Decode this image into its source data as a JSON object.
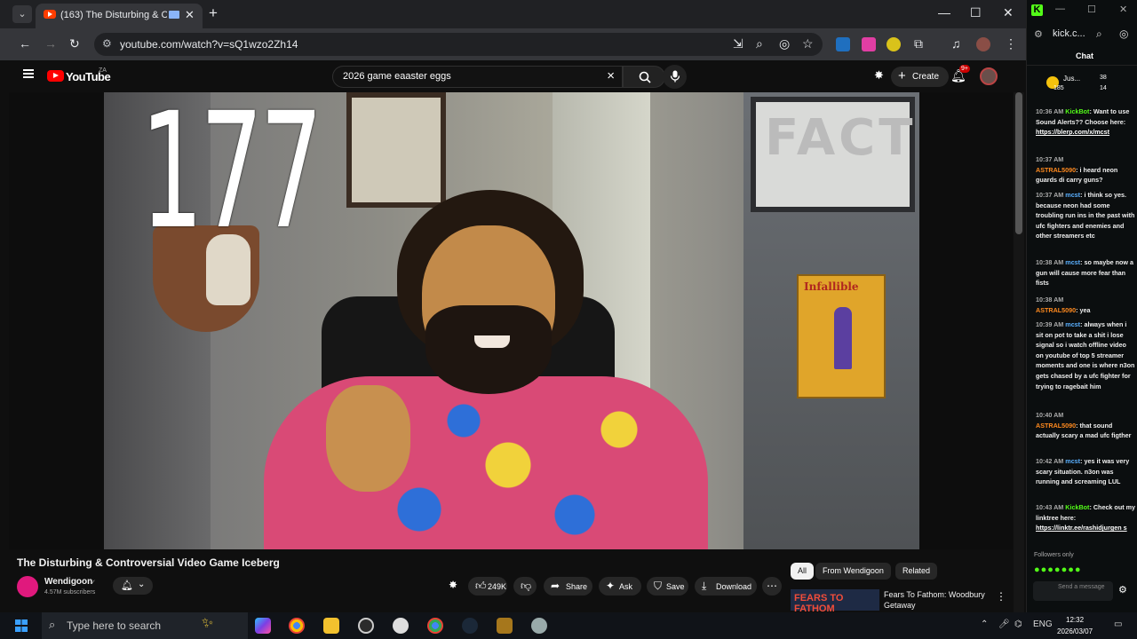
{
  "browser": {
    "tab_title": "(163) The Disturbing & Con",
    "url": "youtube.com/watch?v=sQ1wzo2Zh14",
    "new_tab": "+"
  },
  "youtube": {
    "logo_text": "YouTube",
    "country_code": "ZA",
    "search_query": "2026 game eaaster eggs",
    "create_label": "Create",
    "notification_count": "9+",
    "video": {
      "overlay_number": "177",
      "poster_text": "Infallible",
      "wall_text": "FACT",
      "title": "The Disturbing & Controversial Video Game Iceberg"
    },
    "channel": {
      "name": "Wendigoon",
      "subscribers": "4.57M subscribers"
    },
    "actions": {
      "likes": "249K",
      "share": "Share",
      "ask": "Ask",
      "save": "Save",
      "download": "Download"
    },
    "chips": [
      "All",
      "From Wendigoon",
      "Related"
    ],
    "recommendation": {
      "thumb_text": "FEARS TO FATHOM",
      "title": "Fears To Fathom: Woodbury Getaway"
    }
  },
  "kick": {
    "url": "kick.c...",
    "chat_label": "Chat",
    "user": "Jus...",
    "stats": [
      "185",
      "38",
      "14"
    ],
    "messages": [
      {
        "time": "10:36 AM",
        "name": "KickBot",
        "text": "Want to use Sound Alerts?? Choose here:",
        "link": "https://blerp.com/x/mcst"
      },
      {
        "time": "10:37 AM",
        "name": "ASTRAL5090",
        "text": "i heard neon guards di carry guns?"
      },
      {
        "time": "10:37 AM",
        "name": "mcst",
        "text": "i think so yes. because neon had some troubling run ins in the past with ufc fighters and enemies and other streamers etc"
      },
      {
        "time": "10:38 AM",
        "name": "mcst",
        "text": "so maybe now a gun will cause more fear than fists"
      },
      {
        "time": "10:38 AM",
        "name": "ASTRAL5090",
        "text": "yea"
      },
      {
        "time": "10:39 AM",
        "name": "mcst",
        "text": "always when i sit on pot to take a shit i lose signal so i watch offline video on youtube of top 5 streamer moments and one is where n3on gets chased by a ufc fighter for trying to ragebait him"
      },
      {
        "time": "10:40 AM",
        "name": "ASTRAL5090",
        "text": "that sound actually scary a mad ufc figther"
      },
      {
        "time": "10:42 AM",
        "name": "mcst",
        "text": "yes it was very scary situation. n3on was running and screaming LUL"
      },
      {
        "time": "10:43 AM",
        "name": "KickBot",
        "text": "Check out my linktree here:",
        "link": "https://linktr.ee/rashidjurgen s"
      }
    ],
    "followers_only": "Followers only",
    "send_placeholder": "Send a message"
  },
  "taskbar": {
    "search_placeholder": "Type here to search",
    "lang": "ENG",
    "time": "12:32",
    "date": "2026/03/07"
  },
  "colors": {
    "youtube_red": "#ff0000",
    "kick_green": "#53fc18",
    "chat_orange": "#ff8a1f"
  }
}
